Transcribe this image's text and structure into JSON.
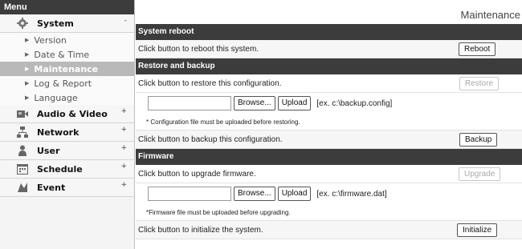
{
  "sidebar": {
    "menu_label": "Menu",
    "categories": [
      {
        "label": "System",
        "toggle": "-",
        "icon": "system-icon",
        "items": [
          {
            "label": "Version"
          },
          {
            "label": "Date & Time"
          },
          {
            "label": "Maintenance",
            "active": true
          },
          {
            "label": "Log & Report"
          },
          {
            "label": "Language"
          }
        ]
      },
      {
        "label": "Audio & Video",
        "toggle": "+",
        "icon": "audio-video-icon"
      },
      {
        "label": "Network",
        "toggle": "+",
        "icon": "network-icon"
      },
      {
        "label": "User",
        "toggle": "+",
        "icon": "user-icon"
      },
      {
        "label": "Schedule",
        "toggle": "+",
        "icon": "schedule-icon"
      },
      {
        "label": "Event",
        "toggle": "+",
        "icon": "event-icon"
      }
    ]
  },
  "page_title": "Maintenance",
  "sections": {
    "reboot": {
      "title": "System reboot",
      "text": "Click button to reboot this system.",
      "button": "Reboot"
    },
    "restore": {
      "title": "Restore and backup",
      "restore_text": "Click button to restore this configuration.",
      "restore_button": "Restore",
      "browse": "Browse...",
      "upload": "Upload",
      "hint": "[ex. c:\\backup.config]",
      "note": "* Configuration file must be uploaded before restoring.",
      "backup_text": "Click button to backup this configuration.",
      "backup_button": "Backup"
    },
    "firmware": {
      "title": "Firmware",
      "upgrade_text": "Click button to upgrade firmware.",
      "upgrade_button": "Upgrade",
      "browse": "Browse...",
      "upload": "Upload",
      "hint": "[ex. c:\\firmware.dat]",
      "note": "*Firmware file must be uploaded before upgrading.",
      "init_text": "Click button to initialize the system.",
      "init_button": "Initialize"
    }
  },
  "colors": {
    "header_bg": "#3c3c3c",
    "active_item_bg": "#b9b9b9",
    "disabled_text": "#a9a9a9"
  }
}
